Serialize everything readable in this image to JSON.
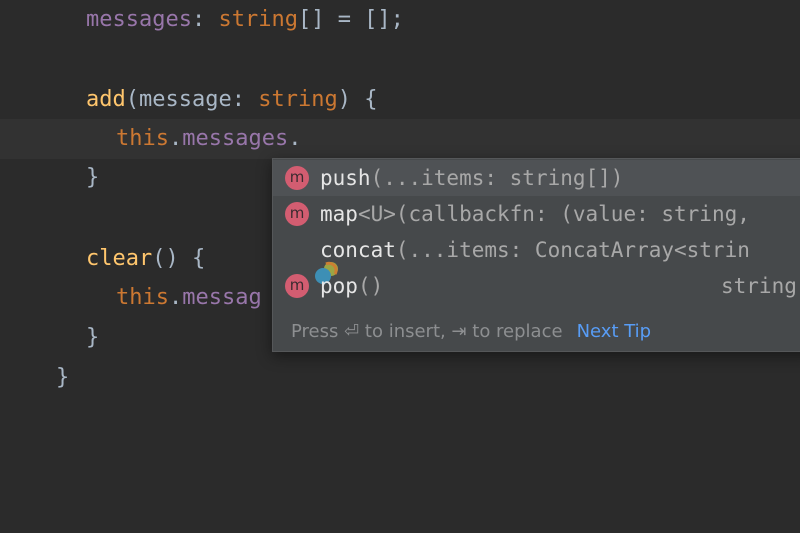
{
  "code": {
    "l1": {
      "prop": "messages",
      "colon": ": ",
      "type": "string",
      "rest": "[] = [];"
    },
    "l2": {
      "fn": "add",
      "open": "(",
      "param": "message: ",
      "type": "string",
      "close": ") {"
    },
    "l3": {
      "kw": "this",
      "dot": ".",
      "prop": "messages",
      "dot2": "."
    },
    "l4": {
      "brace": "}"
    },
    "l5": {
      "fn": "clear",
      "rest": "() {"
    },
    "l6": {
      "kw": "this",
      "dot": ".",
      "prop": "messag"
    },
    "l7": {
      "brace": "}"
    },
    "l8": {
      "brace": "}"
    }
  },
  "completion": {
    "items": [
      {
        "icon": "m",
        "name": "push",
        "sig": "(...items: string[])",
        "type": ""
      },
      {
        "icon": "m",
        "name": "map",
        "sig": "<U>(callbackfn: (value: string,",
        "type": ""
      },
      {
        "icon": "",
        "name": "concat",
        "sig": "(...items: ConcatArray<strin",
        "type": ""
      },
      {
        "icon": "m",
        "name": "pop",
        "sig": "()",
        "type": "string"
      }
    ],
    "hint": "Press ⏎ to insert, ⇥ to replace",
    "next_tip": "Next Tip"
  },
  "colors": {
    "background": "#2b2b2b",
    "keyword": "#cc7832",
    "property": "#9876aa",
    "function": "#ffc66d",
    "method_icon": "#d35d71",
    "link": "#589df6"
  }
}
